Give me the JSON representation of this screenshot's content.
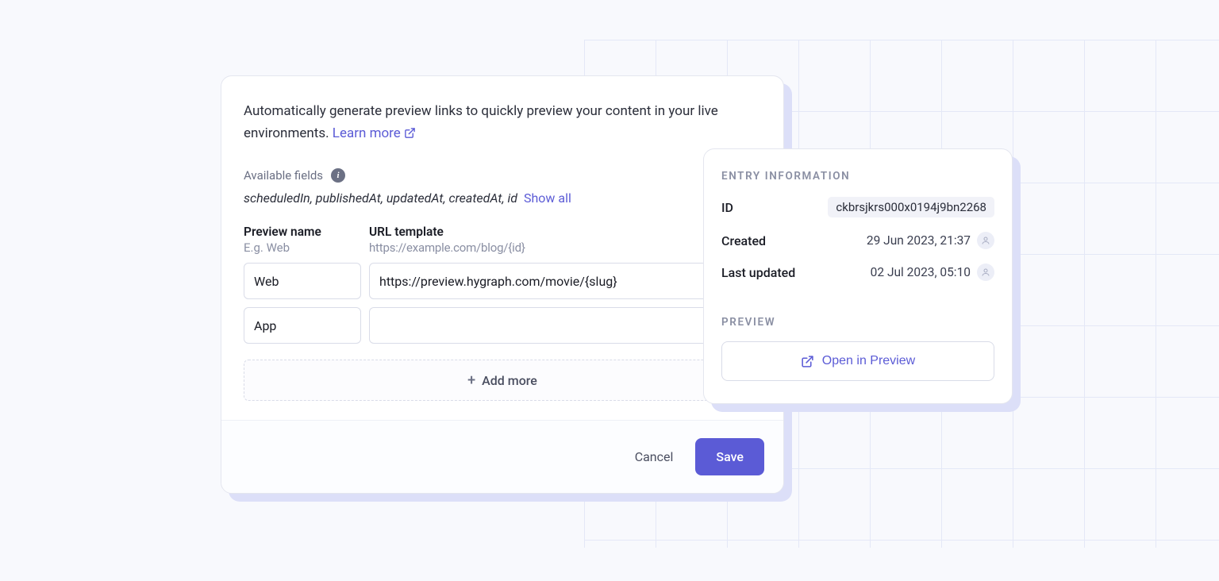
{
  "main": {
    "intro_text": "Automatically generate preview links to quickly preview your content in your live environments. ",
    "learn_more": "Learn more",
    "available_fields_label": "Available fields",
    "fields_list": "scheduledIn, publishedAt, updatedAt, createdAt, id",
    "show_all": "Show all",
    "columns": {
      "preview_name": {
        "label": "Preview name",
        "hint": "E.g. Web"
      },
      "url_template": {
        "label": "URL template",
        "hint": "https://example.com/blog/{id}"
      }
    },
    "rows": [
      {
        "name": "Web",
        "url": "https://preview.hygraph.com/movie/{slug}"
      },
      {
        "name": "App",
        "url": ""
      }
    ],
    "add_more": "Add more",
    "cancel": "Cancel",
    "save": "Save"
  },
  "side": {
    "entry_info_title": "ENTRY INFORMATION",
    "id_label": "ID",
    "id_value": "ckbrsjkrs000x0194j9bn2268",
    "created_label": "Created",
    "created_value": "29 Jun 2023, 21:37",
    "updated_label": "Last updated",
    "updated_value": "02 Jul 2023, 05:10",
    "preview_title": "PREVIEW",
    "open_preview": "Open in Preview"
  }
}
